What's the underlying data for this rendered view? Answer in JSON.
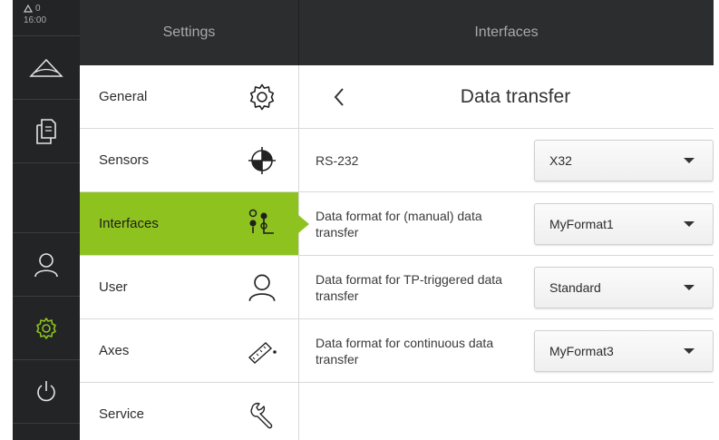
{
  "status": {
    "warning_count": "0",
    "time": "16:00"
  },
  "rail": {
    "items": [
      {
        "icon": "measure-triangle-icon"
      },
      {
        "icon": "documents-icon"
      },
      {
        "icon": "user-icon"
      },
      {
        "icon": "gear-icon"
      },
      {
        "icon": "power-icon"
      }
    ]
  },
  "settings": {
    "header": "Settings",
    "items": [
      {
        "label": "General",
        "icon": "gear-icon"
      },
      {
        "label": "Sensors",
        "icon": "crosshair-icon"
      },
      {
        "label": "Interfaces",
        "icon": "interfaces-icon"
      },
      {
        "label": "User",
        "icon": "user-icon"
      },
      {
        "label": "Axes",
        "icon": "axes-icon"
      },
      {
        "label": "Service",
        "icon": "wrench-icon"
      }
    ],
    "active_index": 2
  },
  "interfaces": {
    "header": "Interfaces",
    "title": "Data transfer",
    "rows": [
      {
        "label": "RS-232",
        "value": "X32"
      },
      {
        "label": "Data format for (manual) data transfer",
        "value": "MyFormat1"
      },
      {
        "label": "Data format for TP-triggered data transfer",
        "value": "Standard"
      },
      {
        "label": "Data format for continuous data transfer",
        "value": "MyFormat3"
      }
    ]
  },
  "colors": {
    "accent": "#8dc21f",
    "rail": "#222425",
    "header": "#2b2d2e"
  }
}
